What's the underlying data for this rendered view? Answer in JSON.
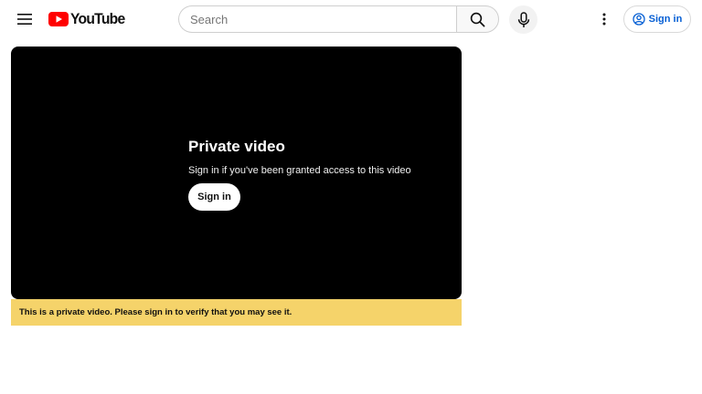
{
  "header": {
    "logo_text": "YouTube",
    "search": {
      "placeholder": "Search",
      "value": ""
    },
    "signin_label": "Sign in"
  },
  "player": {
    "title": "Private video",
    "subtitle": "Sign in if you've been granted access to this video",
    "signin_label": "Sign in"
  },
  "notice": {
    "text": "This is a private video. Please sign in to verify that you may see it."
  },
  "colors": {
    "brand_red": "#ff0000",
    "link_blue": "#065fd4",
    "notice_yellow": "#f5d36a",
    "player_bg": "#000000"
  },
  "icons": [
    "menu-icon",
    "youtube-logo-icon",
    "search-icon",
    "microphone-icon",
    "more-vert-icon",
    "account-circle-icon"
  ]
}
